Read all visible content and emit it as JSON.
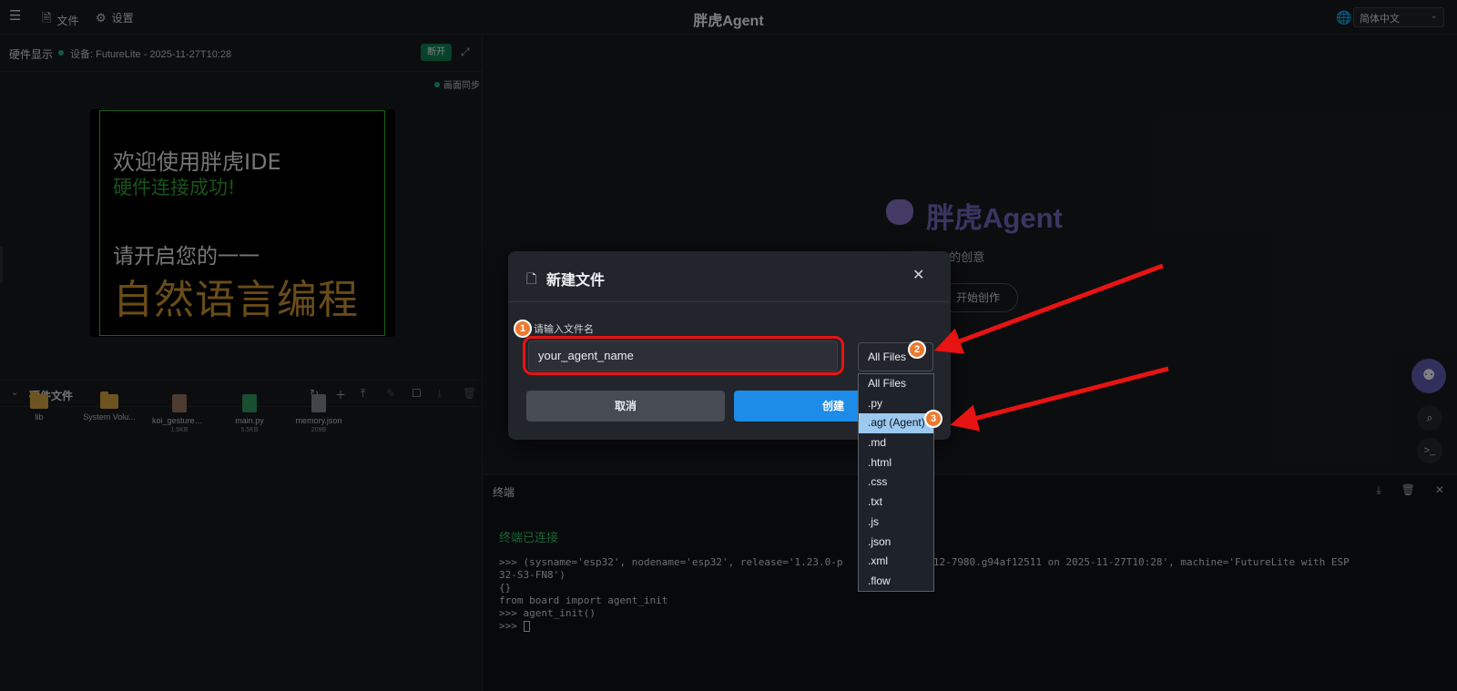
{
  "topbar": {
    "file_label": "文件",
    "settings_label": "设置",
    "app_title": "胖虎Agent",
    "language": "简体中文"
  },
  "hardware": {
    "title": "硬件显示",
    "device": "设备: FutureLite - 2025-11-27T10:28",
    "disconnect_label": "断开",
    "sync_label": "画面同步",
    "screen": {
      "line1": "欢迎使用胖虎IDE",
      "line2": "硬件连接成功!",
      "line3": "请开启您的一一",
      "line4": "自然语言编程"
    }
  },
  "files": {
    "title": "硬件文件",
    "items": [
      {
        "name": "lib",
        "size": ""
      },
      {
        "name": "System Volu...",
        "size": ""
      },
      {
        "name": "koi_gesture_r...",
        "size": "1.5KB"
      },
      {
        "name": "main.py",
        "size": "5.5KB"
      },
      {
        "name": "memory.json",
        "size": "209B"
      }
    ]
  },
  "hero": {
    "title": "胖虎Agent",
    "subtitle": "向AI描述你的创意",
    "start_label": "开始创作"
  },
  "terminal": {
    "title": "终端",
    "connected": "终端已连接",
    "lines": [
      ">>> (sysname='esp32', nodename='esp32', release='1.23.0-p    ersion='v1.12-7980.g94af12511 on 2025-11-27T10:28', machine='FutureLite with ESP",
      "32-S3-FN8')",
      "{}",
      "from board import agent_init",
      ">>> agent_init()",
      ">>> "
    ]
  },
  "modal": {
    "title": "新建文件",
    "label": "请输入文件名",
    "filename_value": "your_agent_name",
    "extension_selected": "All Files",
    "cancel_label": "取消",
    "create_label": "创建"
  },
  "dropdown": {
    "options": [
      "All Files",
      ".py",
      ".agt (Agent)",
      ".md",
      ".html",
      ".css",
      ".txt",
      ".js",
      ".json",
      ".xml",
      ".flow"
    ],
    "highlighted": ".agt (Agent)"
  },
  "annotations": {
    "badges": [
      "1",
      "2",
      "3"
    ],
    "highlight_color": "#e81313",
    "badge_color": "#ec7a2e"
  },
  "colors": {
    "accent_blue": "#1c8ce8",
    "status_green": "#1fa37a",
    "brand_purple": "#6b62b4"
  }
}
